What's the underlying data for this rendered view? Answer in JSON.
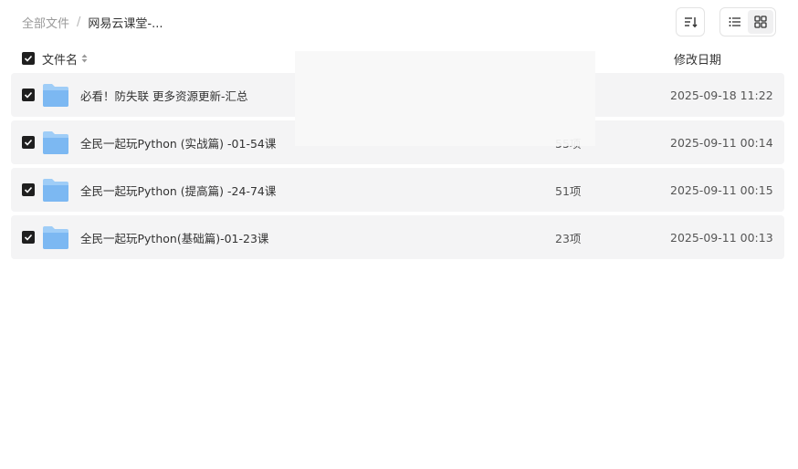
{
  "breadcrumb": {
    "root": "全部文件",
    "separator": "/",
    "current": "网易云课堂-..."
  },
  "toolbar": {
    "sort_icon": "sort-icon",
    "view_modes": [
      {
        "name": "list-view",
        "icon": "list-icon",
        "active": true
      },
      {
        "name": "grid-view",
        "icon": "grid-icon",
        "active": false
      }
    ]
  },
  "table": {
    "header": {
      "name_label": "文件名",
      "date_label": "修改日期"
    },
    "rows": [
      {
        "name": "必看！防失联 更多资源更新-汇总",
        "count": "",
        "date": "2025-09-18 11:22",
        "checked": true
      },
      {
        "name": "全民一起玩Python (实战篇) -01-54课",
        "count": "55项",
        "date": "2025-09-11 00:14",
        "checked": true
      },
      {
        "name": "全民一起玩Python (提高篇) -24-74课",
        "count": "51项",
        "date": "2025-09-11 00:15",
        "checked": true
      },
      {
        "name": "全民一起玩Python(基础篇)-01-23课",
        "count": "23项",
        "date": "2025-09-11 00:13",
        "checked": true
      }
    ]
  },
  "colors": {
    "row_bg": "#f4f4f5",
    "checkbox": "#1f1f1f",
    "folder": "#7cb8f2"
  }
}
